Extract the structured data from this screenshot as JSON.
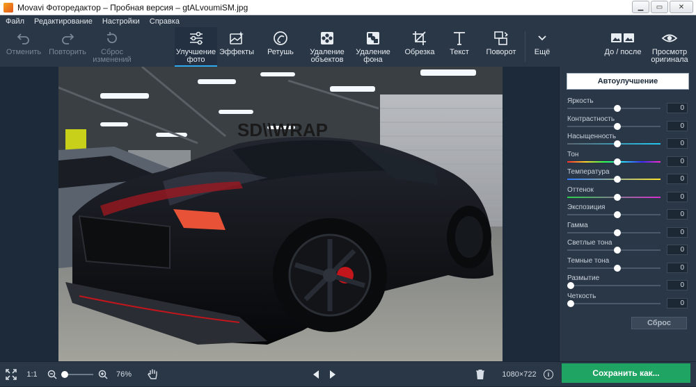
{
  "window": {
    "title": "Movavi Фоторедактор – Пробная версия – gtALvoumiSM.jpg",
    "controls": [
      "▁",
      "▭",
      "✕"
    ]
  },
  "menu": [
    "Файл",
    "Редактирование",
    "Настройки",
    "Справка"
  ],
  "toolbar": {
    "undo": "Отменить",
    "redo": "Повторить",
    "reset_changes": "Сброс\nизменений",
    "enhance": "Улучшение\nфото",
    "effects": "Эффекты",
    "retouch": "Ретушь",
    "object_removal": "Удаление\nобъектов",
    "background_removal": "Удаление\nфона",
    "crop": "Обрезка",
    "text": "Текст",
    "rotate": "Поворот",
    "more": "Ещё",
    "before_after": "До / после",
    "view_original": "Просмотр\nоригинала"
  },
  "photo": {
    "sign_text": "SD\\\\WRAP",
    "colors": {
      "car": "#0b0c10",
      "wall": "#d9e21c",
      "floor": "#8d8e8a",
      "ceiling": "#3a3f44",
      "brake": "#c3161c"
    }
  },
  "panel": {
    "auto_enhance": "Автоулучшение",
    "sliders": [
      {
        "name": "brightness",
        "label": "Яркость",
        "value": "0",
        "position": 0.5,
        "gradient": ""
      },
      {
        "name": "contrast",
        "label": "Контрастность",
        "value": "0",
        "position": 0.5,
        "gradient": ""
      },
      {
        "name": "saturation",
        "label": "Насыщенность",
        "value": "0",
        "position": 0.5,
        "gradient": "sat"
      },
      {
        "name": "hue",
        "label": "Тон",
        "value": "0",
        "position": 0.5,
        "gradient": "hue"
      },
      {
        "name": "temperature",
        "label": "Температура",
        "value": "0",
        "position": 0.5,
        "gradient": "temp"
      },
      {
        "name": "tint",
        "label": "Оттенок",
        "value": "0",
        "position": 0.5,
        "gradient": "tint"
      },
      {
        "name": "exposure",
        "label": "Экспозиция",
        "value": "0",
        "position": 0.5,
        "gradient": ""
      },
      {
        "name": "gamma",
        "label": "Гамма",
        "value": "0",
        "position": 0.5,
        "gradient": ""
      },
      {
        "name": "highlights",
        "label": "Светлые тона",
        "value": "0",
        "position": 0.5,
        "gradient": ""
      },
      {
        "name": "shadows",
        "label": "Темные тона",
        "value": "0",
        "position": 0.5,
        "gradient": ""
      },
      {
        "name": "blur",
        "label": "Размытие",
        "value": "0",
        "position": 0.0,
        "gradient": ""
      },
      {
        "name": "sharpness",
        "label": "Четкость",
        "value": "0",
        "position": 0.0,
        "gradient": ""
      }
    ],
    "reset": "Сброс"
  },
  "bottom": {
    "actual_size": "1:1",
    "zoom_value": 0.05,
    "zoom": "76%",
    "dimensions": "1080×722",
    "info_icon": "i",
    "save": "Сохранить как..."
  },
  "accent_color": "#2fa9f0",
  "save_color": "#1fa463"
}
